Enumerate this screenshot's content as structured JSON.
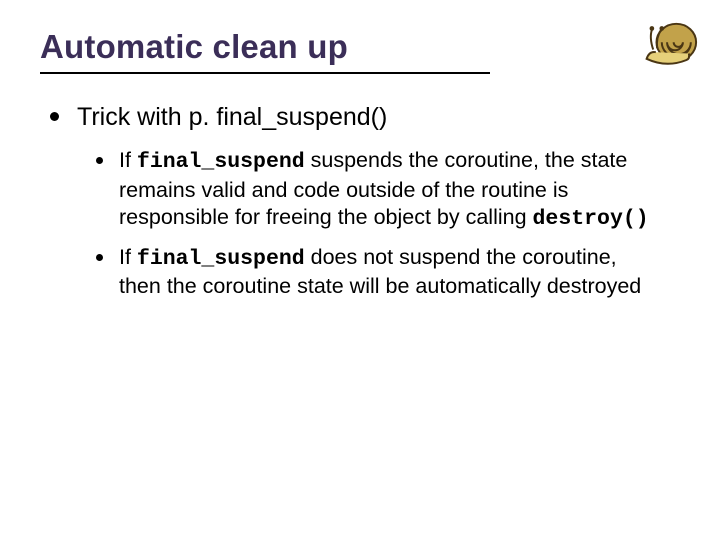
{
  "title": "Automatic clean up",
  "bullets": [
    {
      "text": "Trick with p. final_suspend()",
      "children": [
        {
          "prefix": "If ",
          "code1": "final_suspend",
          "mid1": " suspends the coroutine, the state remains valid and code outside of the routine is responsible for freeing the object by calling ",
          "code2": "destroy()",
          "tail": ""
        },
        {
          "prefix": "If ",
          "code1": "final_suspend",
          "mid1": " does not suspend the coroutine, then the coroutine state will be automatically destroyed",
          "code2": "",
          "tail": ""
        }
      ]
    }
  ],
  "icon": "snail-icon"
}
